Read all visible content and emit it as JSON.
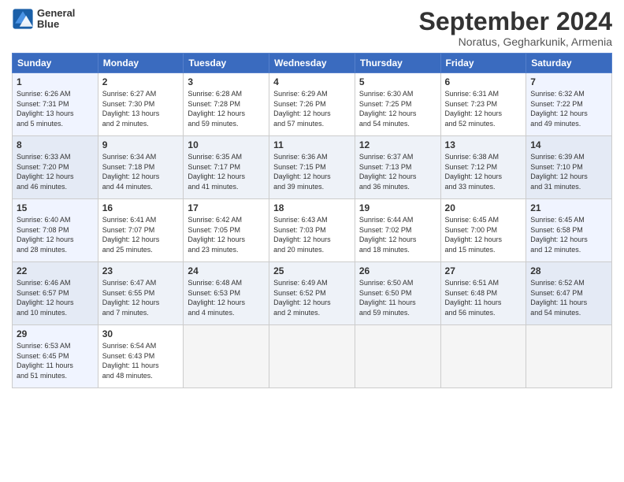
{
  "header": {
    "logo_line1": "General",
    "logo_line2": "Blue",
    "month_title": "September 2024",
    "subtitle": "Noratus, Gegharkunik, Armenia"
  },
  "weekdays": [
    "Sunday",
    "Monday",
    "Tuesday",
    "Wednesday",
    "Thursday",
    "Friday",
    "Saturday"
  ],
  "weeks": [
    [
      {
        "day": "1",
        "info": "Sunrise: 6:26 AM\nSunset: 7:31 PM\nDaylight: 13 hours\nand 5 minutes.",
        "type": "sunday"
      },
      {
        "day": "2",
        "info": "Sunrise: 6:27 AM\nSunset: 7:30 PM\nDaylight: 13 hours\nand 2 minutes.",
        "type": ""
      },
      {
        "day": "3",
        "info": "Sunrise: 6:28 AM\nSunset: 7:28 PM\nDaylight: 12 hours\nand 59 minutes.",
        "type": ""
      },
      {
        "day": "4",
        "info": "Sunrise: 6:29 AM\nSunset: 7:26 PM\nDaylight: 12 hours\nand 57 minutes.",
        "type": ""
      },
      {
        "day": "5",
        "info": "Sunrise: 6:30 AM\nSunset: 7:25 PM\nDaylight: 12 hours\nand 54 minutes.",
        "type": ""
      },
      {
        "day": "6",
        "info": "Sunrise: 6:31 AM\nSunset: 7:23 PM\nDaylight: 12 hours\nand 52 minutes.",
        "type": ""
      },
      {
        "day": "7",
        "info": "Sunrise: 6:32 AM\nSunset: 7:22 PM\nDaylight: 12 hours\nand 49 minutes.",
        "type": "saturday"
      }
    ],
    [
      {
        "day": "8",
        "info": "Sunrise: 6:33 AM\nSunset: 7:20 PM\nDaylight: 12 hours\nand 46 minutes.",
        "type": "sunday"
      },
      {
        "day": "9",
        "info": "Sunrise: 6:34 AM\nSunset: 7:18 PM\nDaylight: 12 hours\nand 44 minutes.",
        "type": ""
      },
      {
        "day": "10",
        "info": "Sunrise: 6:35 AM\nSunset: 7:17 PM\nDaylight: 12 hours\nand 41 minutes.",
        "type": ""
      },
      {
        "day": "11",
        "info": "Sunrise: 6:36 AM\nSunset: 7:15 PM\nDaylight: 12 hours\nand 39 minutes.",
        "type": ""
      },
      {
        "day": "12",
        "info": "Sunrise: 6:37 AM\nSunset: 7:13 PM\nDaylight: 12 hours\nand 36 minutes.",
        "type": ""
      },
      {
        "day": "13",
        "info": "Sunrise: 6:38 AM\nSunset: 7:12 PM\nDaylight: 12 hours\nand 33 minutes.",
        "type": ""
      },
      {
        "day": "14",
        "info": "Sunrise: 6:39 AM\nSunset: 7:10 PM\nDaylight: 12 hours\nand 31 minutes.",
        "type": "saturday"
      }
    ],
    [
      {
        "day": "15",
        "info": "Sunrise: 6:40 AM\nSunset: 7:08 PM\nDaylight: 12 hours\nand 28 minutes.",
        "type": "sunday"
      },
      {
        "day": "16",
        "info": "Sunrise: 6:41 AM\nSunset: 7:07 PM\nDaylight: 12 hours\nand 25 minutes.",
        "type": ""
      },
      {
        "day": "17",
        "info": "Sunrise: 6:42 AM\nSunset: 7:05 PM\nDaylight: 12 hours\nand 23 minutes.",
        "type": ""
      },
      {
        "day": "18",
        "info": "Sunrise: 6:43 AM\nSunset: 7:03 PM\nDaylight: 12 hours\nand 20 minutes.",
        "type": ""
      },
      {
        "day": "19",
        "info": "Sunrise: 6:44 AM\nSunset: 7:02 PM\nDaylight: 12 hours\nand 18 minutes.",
        "type": ""
      },
      {
        "day": "20",
        "info": "Sunrise: 6:45 AM\nSunset: 7:00 PM\nDaylight: 12 hours\nand 15 minutes.",
        "type": ""
      },
      {
        "day": "21",
        "info": "Sunrise: 6:45 AM\nSunset: 6:58 PM\nDaylight: 12 hours\nand 12 minutes.",
        "type": "saturday"
      }
    ],
    [
      {
        "day": "22",
        "info": "Sunrise: 6:46 AM\nSunset: 6:57 PM\nDaylight: 12 hours\nand 10 minutes.",
        "type": "sunday"
      },
      {
        "day": "23",
        "info": "Sunrise: 6:47 AM\nSunset: 6:55 PM\nDaylight: 12 hours\nand 7 minutes.",
        "type": ""
      },
      {
        "day": "24",
        "info": "Sunrise: 6:48 AM\nSunset: 6:53 PM\nDaylight: 12 hours\nand 4 minutes.",
        "type": ""
      },
      {
        "day": "25",
        "info": "Sunrise: 6:49 AM\nSunset: 6:52 PM\nDaylight: 12 hours\nand 2 minutes.",
        "type": ""
      },
      {
        "day": "26",
        "info": "Sunrise: 6:50 AM\nSunset: 6:50 PM\nDaylight: 11 hours\nand 59 minutes.",
        "type": ""
      },
      {
        "day": "27",
        "info": "Sunrise: 6:51 AM\nSunset: 6:48 PM\nDaylight: 11 hours\nand 56 minutes.",
        "type": ""
      },
      {
        "day": "28",
        "info": "Sunrise: 6:52 AM\nSunset: 6:47 PM\nDaylight: 11 hours\nand 54 minutes.",
        "type": "saturday"
      }
    ],
    [
      {
        "day": "29",
        "info": "Sunrise: 6:53 AM\nSunset: 6:45 PM\nDaylight: 11 hours\nand 51 minutes.",
        "type": "sunday"
      },
      {
        "day": "30",
        "info": "Sunrise: 6:54 AM\nSunset: 6:43 PM\nDaylight: 11 hours\nand 48 minutes.",
        "type": ""
      },
      {
        "day": "",
        "info": "",
        "type": "empty"
      },
      {
        "day": "",
        "info": "",
        "type": "empty"
      },
      {
        "day": "",
        "info": "",
        "type": "empty"
      },
      {
        "day": "",
        "info": "",
        "type": "empty"
      },
      {
        "day": "",
        "info": "",
        "type": "empty"
      }
    ]
  ]
}
